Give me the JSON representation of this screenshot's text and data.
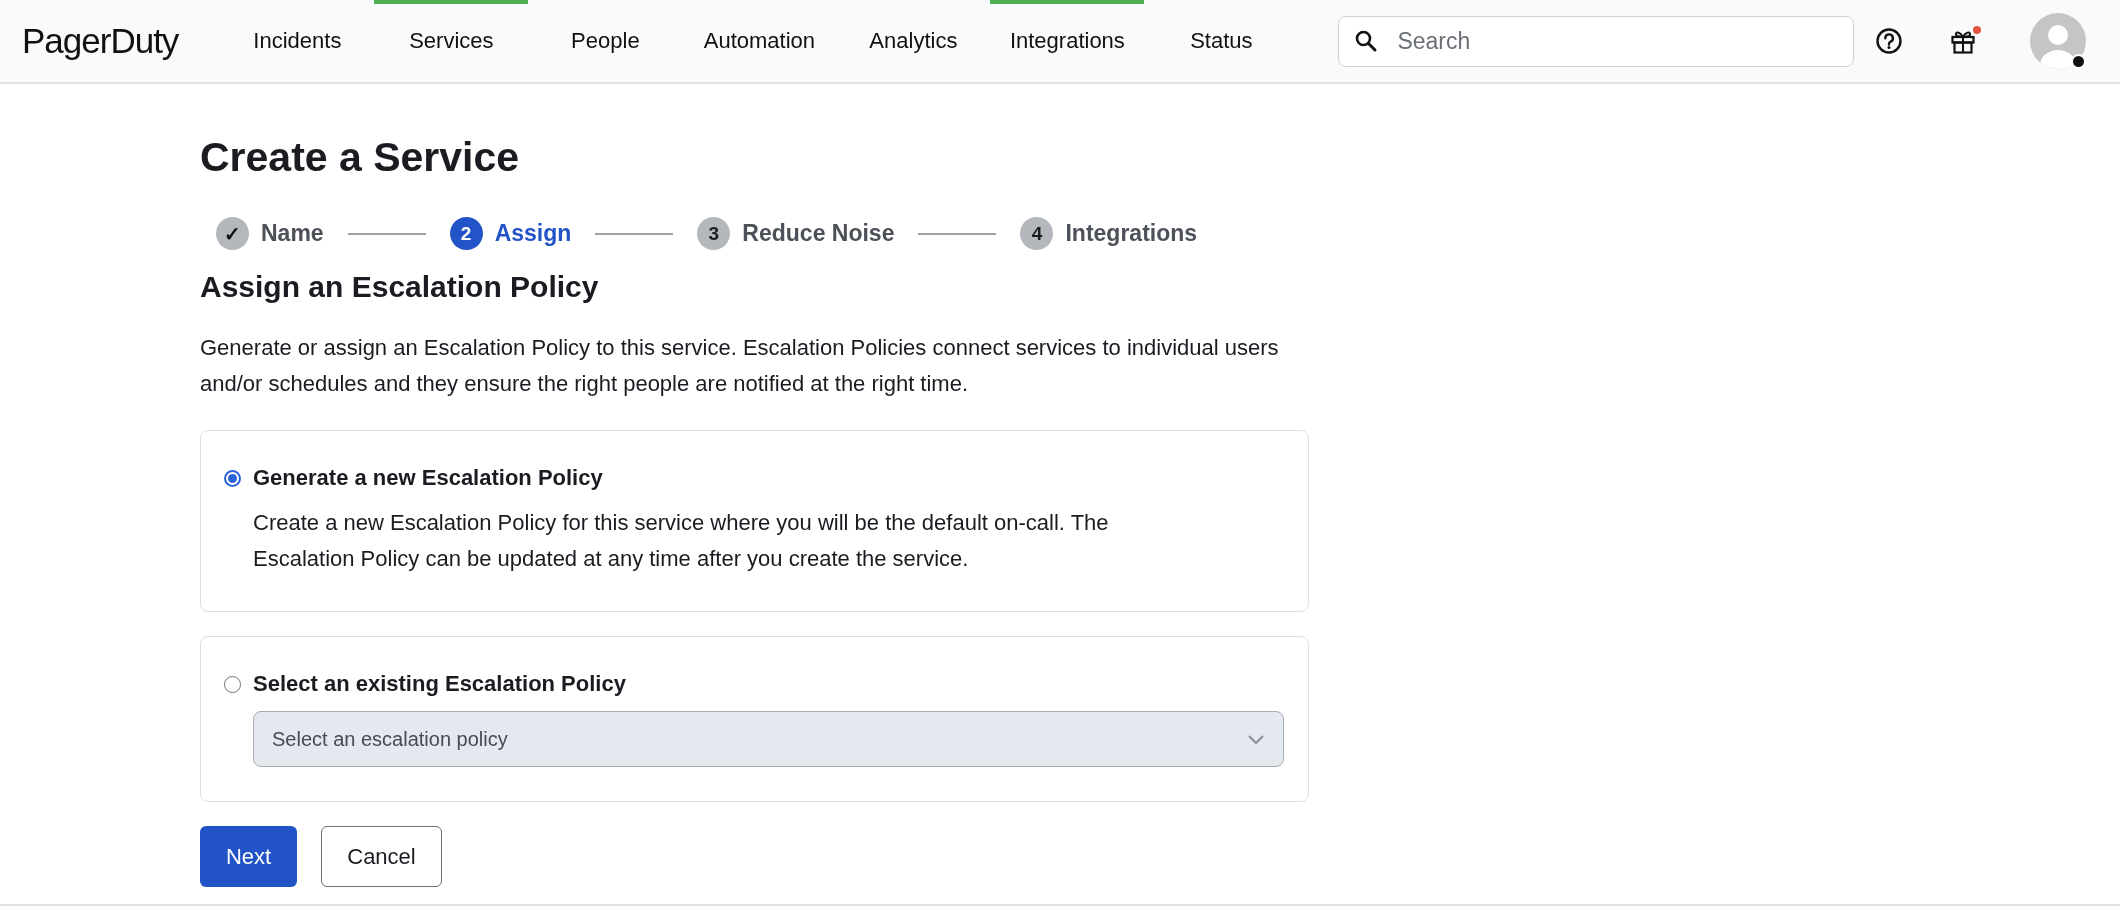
{
  "top_nav": {
    "logo": "PagerDuty",
    "items": [
      {
        "label": "Incidents",
        "selected": false
      },
      {
        "label": "Services",
        "selected": true
      },
      {
        "label": "People",
        "selected": false
      },
      {
        "label": "Automation",
        "selected": false
      },
      {
        "label": "Analytics",
        "selected": false
      },
      {
        "label": "Integrations",
        "selected": true
      },
      {
        "label": "Status",
        "selected": false
      }
    ],
    "search": {
      "placeholder": "Search"
    },
    "gift_notification": true
  },
  "page": {
    "title": "Create a Service",
    "steps": [
      {
        "marker": "✓",
        "label": "Name",
        "done": true,
        "selected": false
      },
      {
        "marker": "2",
        "label": "Assign",
        "done": false,
        "selected": true
      },
      {
        "marker": "3",
        "label": "Reduce Noise",
        "done": false,
        "selected": false
      },
      {
        "marker": "4",
        "label": "Integrations",
        "done": false,
        "selected": false
      }
    ],
    "heading": "Assign an Escalation Policy",
    "description": "Generate or assign an Escalation Policy to this service. Escalation Policies connect services to individual users and/or schedules and they ensure the right people are notified at the right time.",
    "options": [
      {
        "kind": "text",
        "label": "Generate a new Escalation Policy",
        "selected": true,
        "detail": "Create a new Escalation Policy for this service where you will be the default on-call. The Escalation Policy can be updated at any time after you create the service."
      },
      {
        "kind": "select",
        "label": "Select an existing Escalation Policy",
        "selected": false,
        "placeholder": "Select an escalation policy",
        "disabled": true
      }
    ],
    "buttons": [
      {
        "label": "Next",
        "kind": "primary"
      },
      {
        "label": "Cancel",
        "kind": "secondary"
      }
    ]
  }
}
